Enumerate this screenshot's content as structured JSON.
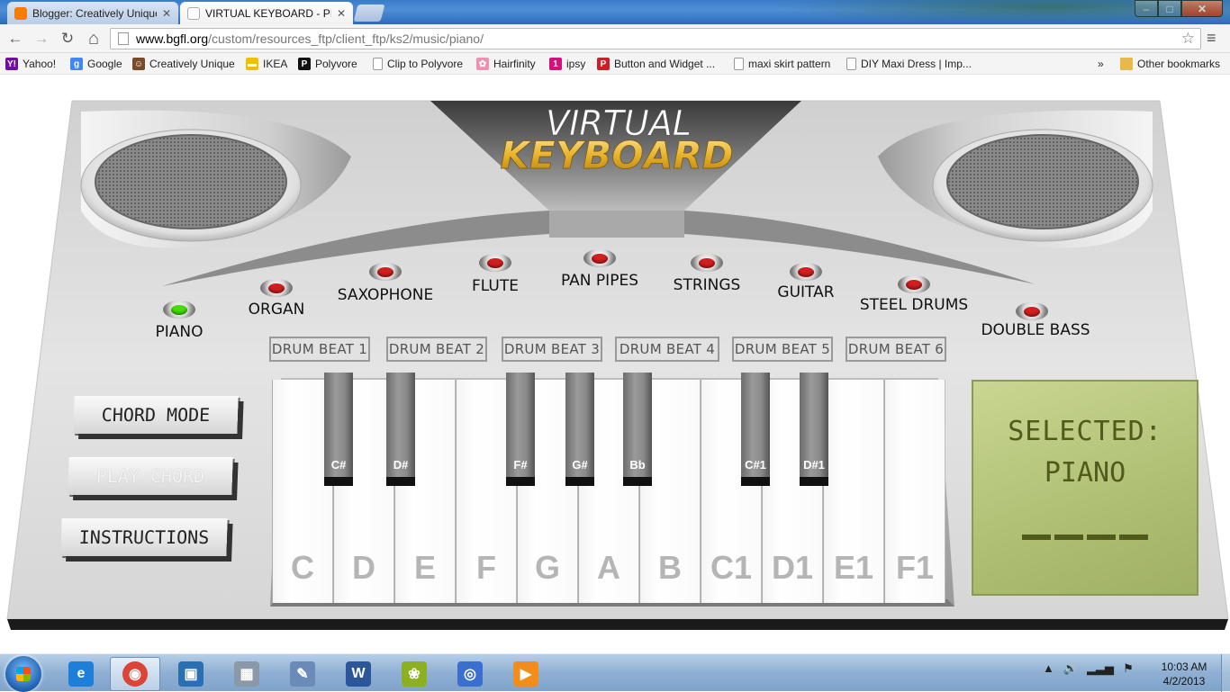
{
  "tabs": [
    {
      "label": "Blogger: Creatively Unique",
      "active": false,
      "favicon_color": "#f57d00"
    },
    {
      "label": "VIRTUAL KEYBOARD - PIA",
      "active": true,
      "favicon_color": "#ffffff"
    }
  ],
  "window_controls": {
    "minimize": "–",
    "maximize": "□",
    "close": "✕"
  },
  "toolbar": {
    "back_icon": "←",
    "forward_icon": "→",
    "reload_icon": "↻",
    "home_icon": "⌂",
    "url_host": "www.bgfl.org",
    "url_path": "/custom/resources_ftp/client_ftp/ks2/music/piano/",
    "star_icon": "☆",
    "menu_icon": "≡"
  },
  "bookmarks": [
    {
      "label": "Yahoo!",
      "icon": "Y!",
      "color": "#720e9e"
    },
    {
      "label": "Google",
      "icon": "g",
      "color": "#4285f4"
    },
    {
      "label": "Creatively Unique",
      "icon": "☺",
      "color": "#7a4a2a"
    },
    {
      "label": "IKEA",
      "icon": "▬",
      "color": "#f0c000"
    },
    {
      "label": "Polyvore",
      "icon": "P",
      "color": "#111111"
    },
    {
      "label": "Clip to Polyvore",
      "icon": "",
      "color": "#ffffff"
    },
    {
      "label": "Hairfinity",
      "icon": "✿",
      "color": "#f090b0"
    },
    {
      "label": "ipsy",
      "icon": "1",
      "color": "#d2127a"
    },
    {
      "label": "Button and Widget ...",
      "icon": "P",
      "color": "#cb2027"
    },
    {
      "label": "maxi skirt pattern",
      "icon": "",
      "color": "#ffffff"
    },
    {
      "label": "DIY Maxi Dress | Imp...",
      "icon": "",
      "color": "#ffffff"
    }
  ],
  "bookmarks_overflow": "»",
  "other_bookmarks": "Other bookmarks",
  "app": {
    "title_line1": "VIRTUAL",
    "title_line2": "KEYBOARD",
    "instruments": [
      {
        "label": "PIANO",
        "led": "#44e000",
        "selected": true
      },
      {
        "label": "ORGAN",
        "led": "#d21f1f",
        "selected": false
      },
      {
        "label": "SAXOPHONE",
        "led": "#d21f1f",
        "selected": false
      },
      {
        "label": "FLUTE",
        "led": "#d21f1f",
        "selected": false
      },
      {
        "label": "PAN PIPES",
        "led": "#d21f1f",
        "selected": false
      },
      {
        "label": "STRINGS",
        "led": "#d21f1f",
        "selected": false
      },
      {
        "label": "GUITAR",
        "led": "#d21f1f",
        "selected": false
      },
      {
        "label": "STEEL DRUMS",
        "led": "#d21f1f",
        "selected": false
      },
      {
        "label": "DOUBLE BASS",
        "led": "#d21f1f",
        "selected": false
      }
    ],
    "drum_beats": [
      "DRUM BEAT 1",
      "DRUM BEAT 2",
      "DRUM BEAT 3",
      "DRUM BEAT 4",
      "DRUM BEAT 5",
      "DRUM BEAT 6"
    ],
    "side_buttons": [
      {
        "label": "CHORD MODE",
        "enabled": true
      },
      {
        "label": "PLAY CHORD",
        "enabled": false
      },
      {
        "label": "INSTRUCTIONS",
        "enabled": true
      }
    ],
    "white_keys": [
      "C",
      "D",
      "E",
      "F",
      "G",
      "A",
      "B",
      "C1",
      "D1",
      "E1",
      "F1"
    ],
    "black_keys": [
      "C#",
      "D#",
      "F#",
      "G#",
      "Bb",
      "C#1",
      "D#1"
    ],
    "display": {
      "title": "SELECTED:",
      "instrument": "PIANO",
      "bar_count": 4
    }
  },
  "taskbar": {
    "apps": [
      {
        "name": "internet-explorer",
        "glyph": "e",
        "color": "#1e7fd8"
      },
      {
        "name": "chrome",
        "glyph": "◉",
        "color": "#db4437"
      },
      {
        "name": "photo-viewer",
        "glyph": "▣",
        "color": "#2a6fb0"
      },
      {
        "name": "calculator",
        "glyph": "▦",
        "color": "#8a98a8"
      },
      {
        "name": "paint",
        "glyph": "✎",
        "color": "#6a8ab8"
      },
      {
        "name": "word",
        "glyph": "W",
        "color": "#2b579a"
      },
      {
        "name": "frog-app",
        "glyph": "❀",
        "color": "#8cb020"
      },
      {
        "name": "eyes-app",
        "glyph": "◎",
        "color": "#3a6fcf"
      },
      {
        "name": "media-player",
        "glyph": "▶",
        "color": "#f28c1a"
      }
    ],
    "clock_time": "10:03 AM",
    "clock_date": "4/2/2013"
  }
}
